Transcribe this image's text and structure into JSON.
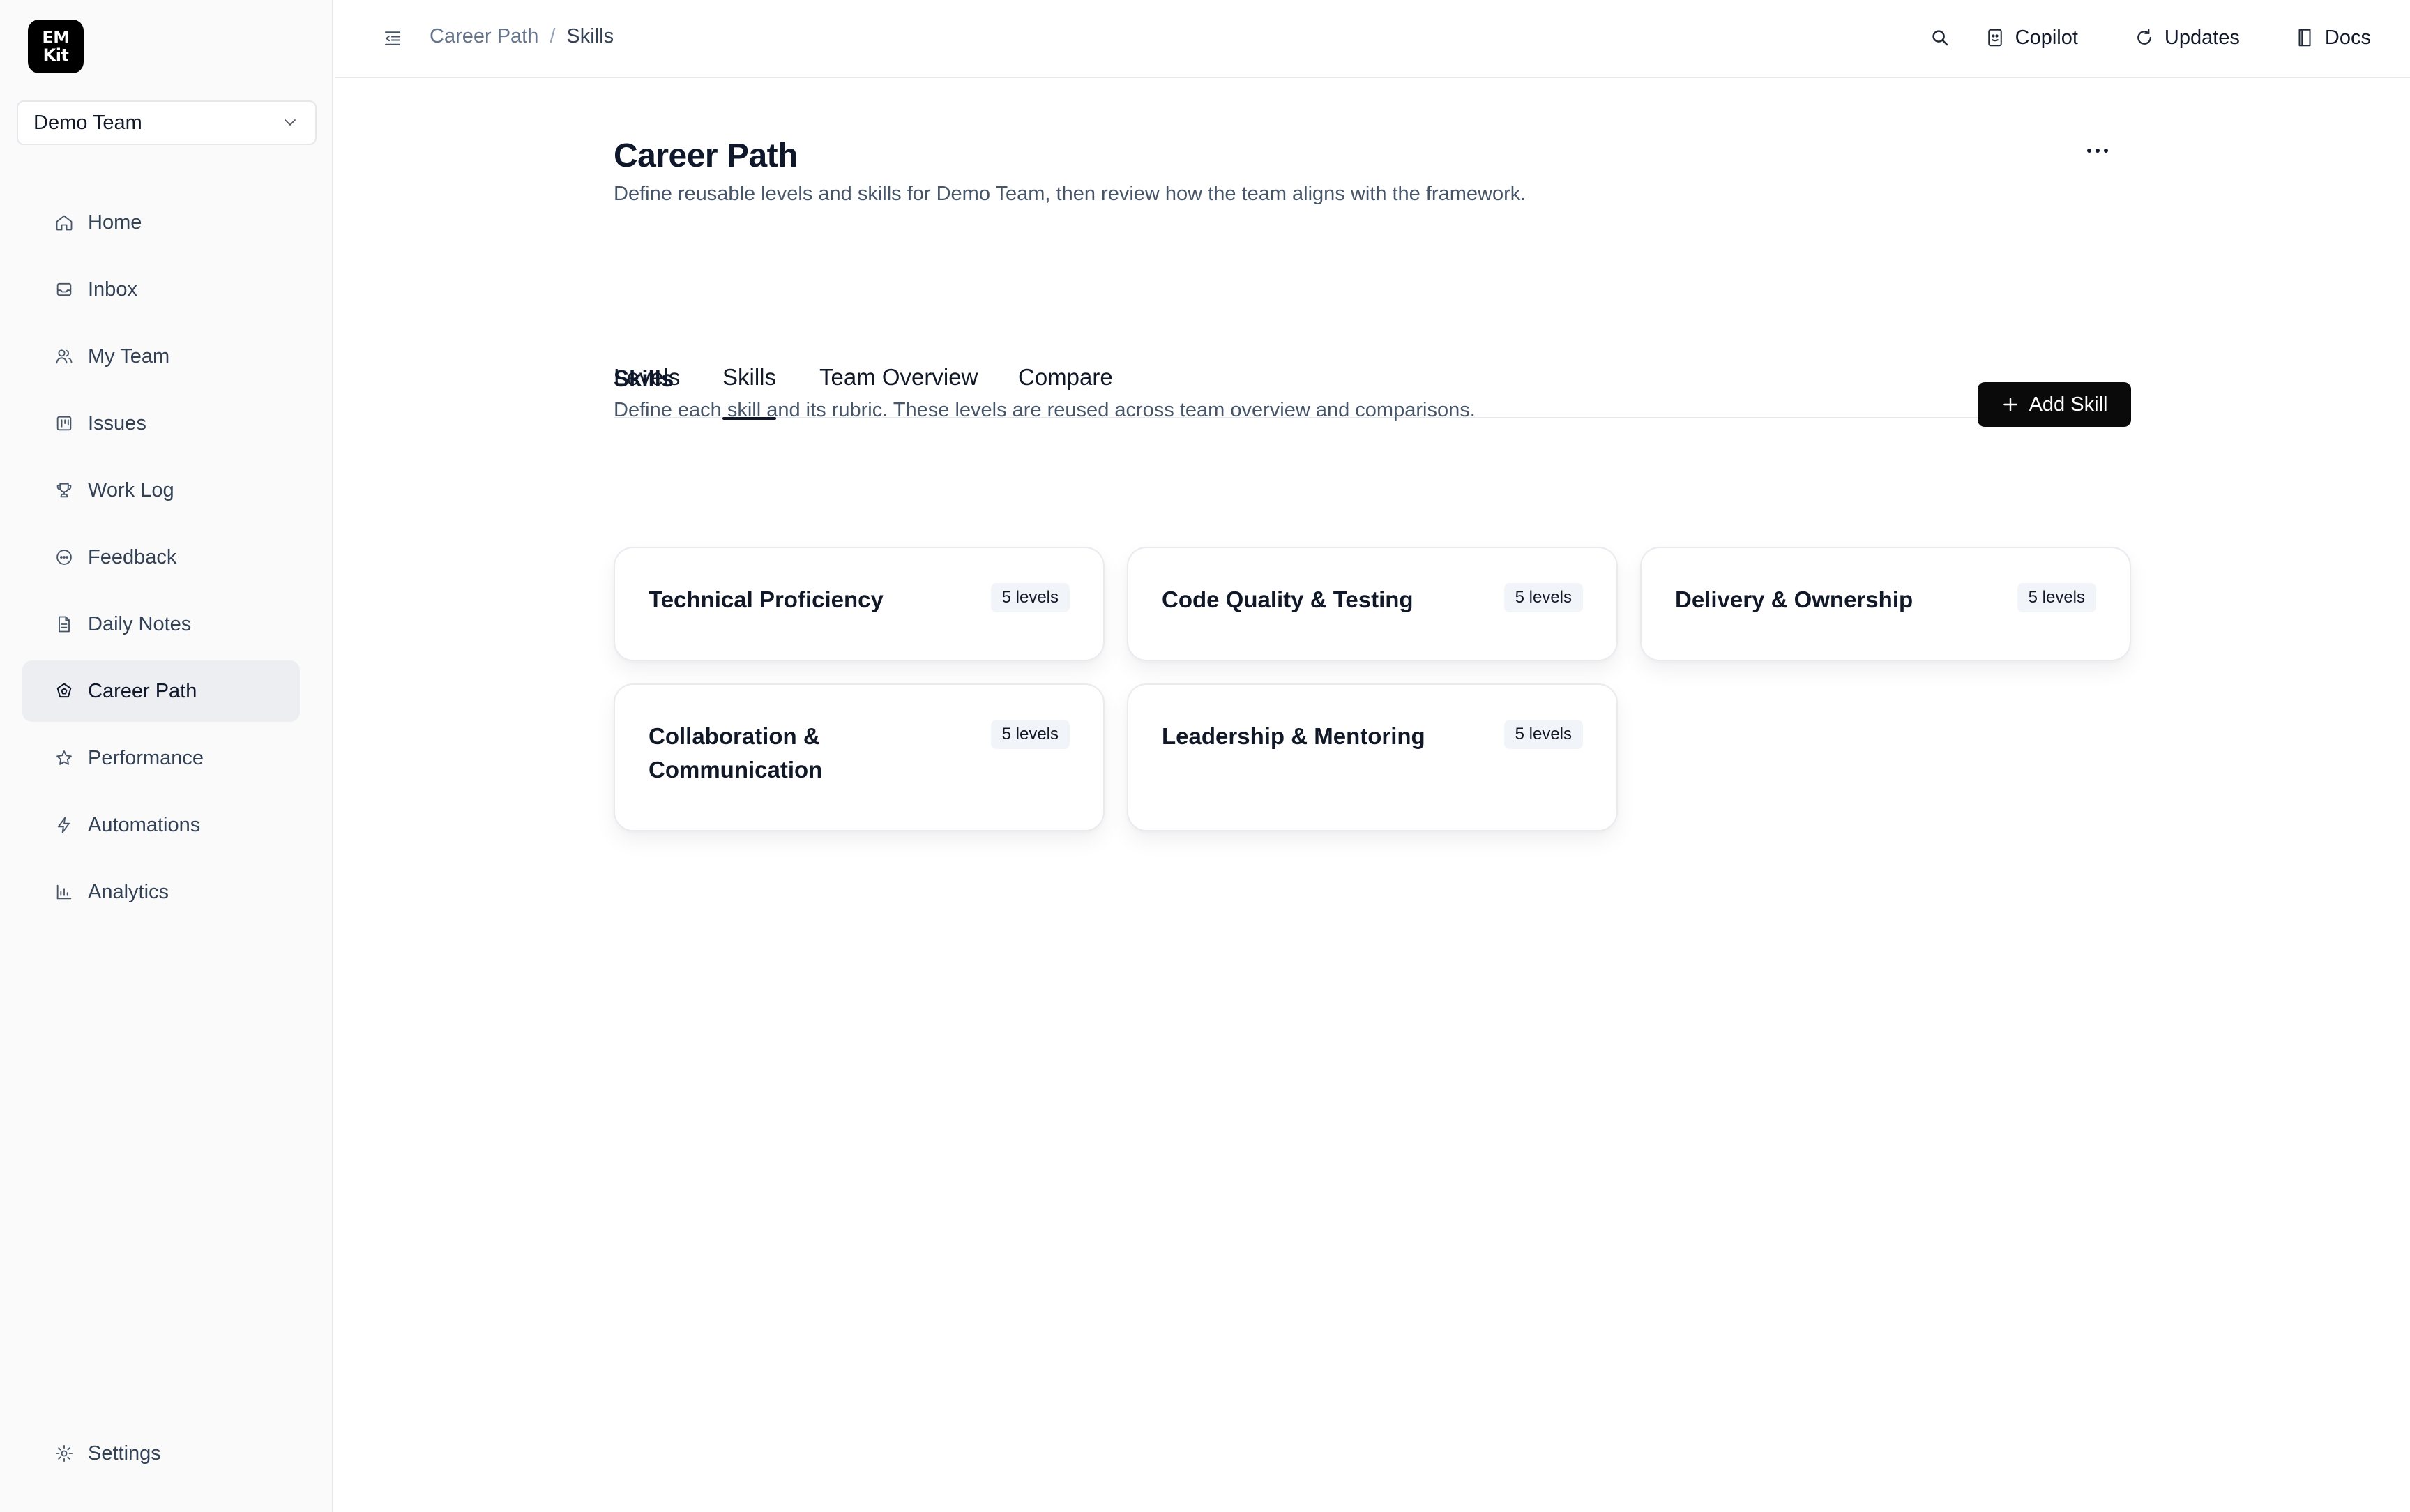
{
  "app": {
    "logo_line1": "EM",
    "logo_line2": "Kit"
  },
  "team_selector": {
    "value": "Demo Team"
  },
  "sidebar": {
    "items": [
      {
        "label": "Home",
        "icon": "home-icon"
      },
      {
        "label": "Inbox",
        "icon": "inbox-icon"
      },
      {
        "label": "My Team",
        "icon": "users-icon"
      },
      {
        "label": "Issues",
        "icon": "kanban-icon"
      },
      {
        "label": "Work Log",
        "icon": "trophy-icon"
      },
      {
        "label": "Feedback",
        "icon": "chat-icon"
      },
      {
        "label": "Daily Notes",
        "icon": "document-icon"
      },
      {
        "label": "Career Path",
        "icon": "career-icon",
        "active": true
      },
      {
        "label": "Performance",
        "icon": "star-icon"
      },
      {
        "label": "Automations",
        "icon": "bolt-icon"
      },
      {
        "label": "Analytics",
        "icon": "bar-chart-icon"
      }
    ],
    "settings_label": "Settings"
  },
  "topbar": {
    "breadcrumb": {
      "parent": "Career Path",
      "separator": "/",
      "current": "Skills"
    },
    "copilot_label": "Copilot",
    "updates_label": "Updates",
    "docs_label": "Docs"
  },
  "page": {
    "title": "Career Path",
    "subtitle": "Define reusable levels and skills for Demo Team, then review how the team aligns with the framework.",
    "tabs": [
      {
        "label": "Levels"
      },
      {
        "label": "Skills",
        "active": true
      },
      {
        "label": "Team Overview"
      },
      {
        "label": "Compare"
      }
    ]
  },
  "skills_section": {
    "title": "Skills",
    "subtitle": "Define each skill and its rubric. These levels are reused across team overview and comparisons.",
    "add_label": "Add Skill",
    "cards": [
      {
        "title": "Technical Proficiency",
        "badge": "5 levels"
      },
      {
        "title": "Code Quality & Testing",
        "badge": "5 levels"
      },
      {
        "title": "Delivery & Ownership",
        "badge": "5 levels"
      },
      {
        "title": "Collaboration & Communication",
        "badge": "5 levels"
      },
      {
        "title": "Leadership & Mentoring",
        "badge": "5 levels"
      }
    ]
  },
  "colors": {
    "primary_button": "#0a0a0a",
    "active_nav_bg": "#eceef1",
    "border": "#e5e7eb",
    "muted_text": "#475569"
  }
}
